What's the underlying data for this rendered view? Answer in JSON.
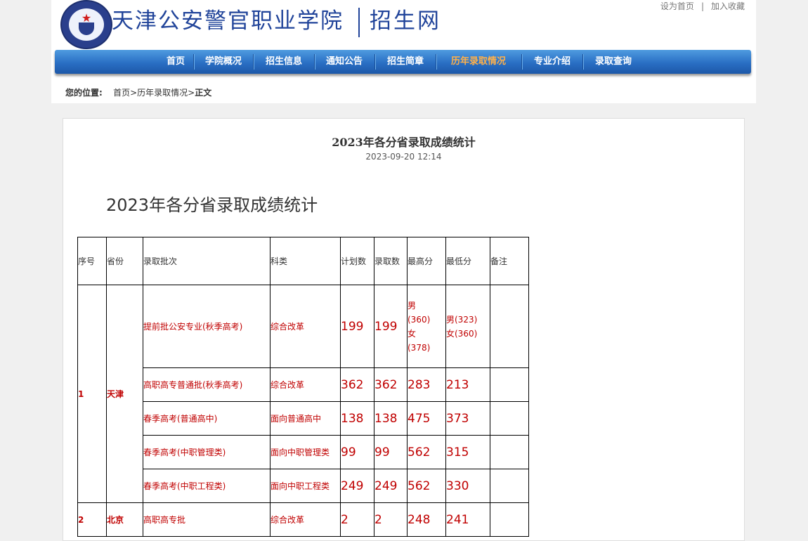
{
  "header": {
    "site_title": "天津公安警官职业学院",
    "site_sub": "招生网",
    "links": [
      "设为首页",
      "加入收藏"
    ]
  },
  "nav": {
    "items": [
      "首页",
      "学院概况",
      "招生信息",
      "通知公告",
      "招生简章",
      "历年录取情况",
      "专业介绍",
      "录取查询"
    ],
    "active": "历年录取情况"
  },
  "breadcrumb": {
    "label": "您的位置:",
    "path1": "首页",
    "sep": ">",
    "path2": "历年录取情况",
    "current": "正文"
  },
  "article": {
    "title": "2023年各分省录取成绩统计",
    "date": "2023-09-20 12:14",
    "heading": "2023年各分省录取成绩统计"
  },
  "table": {
    "headers": [
      "序号",
      "省份",
      "录取批次",
      "科类",
      "计划数",
      "录取数",
      "最高分",
      "最低分",
      "备注"
    ],
    "groups": [
      {
        "no": "1",
        "province": "天津",
        "rows": [
          {
            "batch": "提前批公安专业(秋季高考)",
            "type": "综合改革",
            "plan": "199",
            "admit": "199",
            "max": [
              "男",
              "(360)",
              "女",
              "(378)"
            ],
            "min": [
              "男(323)",
              "女(360)"
            ],
            "note": ""
          },
          {
            "batch": "高职高专普通批(秋季高考)",
            "type": "综合改革",
            "plan": "362",
            "admit": "362",
            "max": [
              "283"
            ],
            "min": [
              "213"
            ],
            "note": ""
          },
          {
            "batch": "春季高考(普通高中)",
            "type": "面向普通高中",
            "plan": "138",
            "admit": "138",
            "max": [
              "475"
            ],
            "min": [
              "373"
            ],
            "note": ""
          },
          {
            "batch": "春季高考(中职管理类)",
            "type": "面向中职管理类",
            "plan": "99",
            "admit": "99",
            "max": [
              "562"
            ],
            "min": [
              "315"
            ],
            "note": ""
          },
          {
            "batch": "春季高考(中职工程类)",
            "type": "面向中职工程类",
            "plan": "249",
            "admit": "249",
            "max": [
              "562"
            ],
            "min": [
              "330"
            ],
            "note": ""
          }
        ]
      },
      {
        "no": "2",
        "province": "北京",
        "rows": [
          {
            "batch": "高职高专批",
            "type": "综合改革",
            "plan": "2",
            "admit": "2",
            "max": [
              "248"
            ],
            "min": [
              "241"
            ],
            "note": ""
          }
        ]
      }
    ]
  }
}
